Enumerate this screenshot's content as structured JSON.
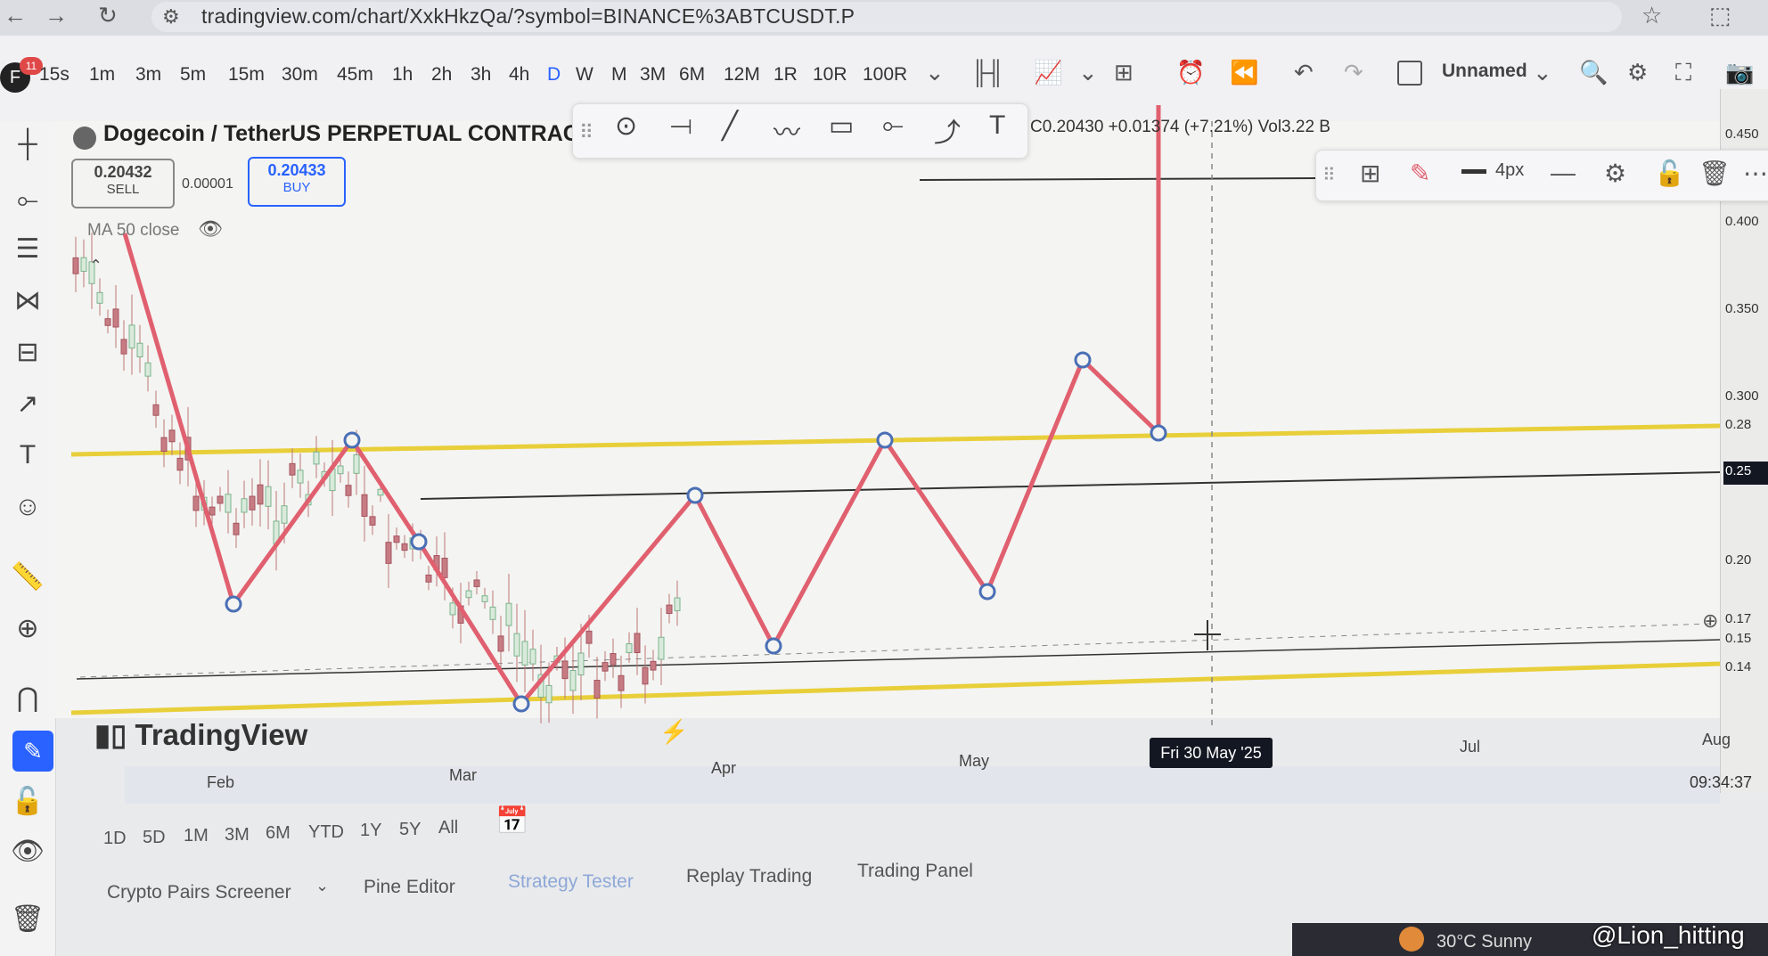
{
  "browser": {
    "url": "tradingview.com/chart/XxkHkzQa/?symbol=BINANCE%3ABTCUSDT.P",
    "back_icon": "back-arrow-icon",
    "forward_icon": "forward-arrow-icon",
    "reload_icon": "reload-icon"
  },
  "toolbar": {
    "avatar_letter": "F",
    "notification_count": "11",
    "intervals": [
      "15s",
      "1m",
      "3m",
      "5m",
      "15m",
      "30m",
      "45m",
      "1h",
      "2h",
      "3h",
      "4h",
      "D",
      "W",
      "M",
      "3M",
      "6M",
      "12M",
      "1R",
      "10R",
      "100R"
    ],
    "active_interval": "D",
    "layout_name": "Unnamed"
  },
  "symbol": {
    "title": "Dogecoin / TetherUS PERPETUAL CONTRACT ·",
    "sell_price": "0.20432",
    "sell_label": "SELL",
    "spread": "0.00001",
    "buy_price": "0.20433",
    "buy_label": "BUY",
    "indicator": "MA 50 close",
    "ohlc": "C0.20430 +0.01374 (+7.21%) Vol3.22 B"
  },
  "line_style": {
    "width_label": "4px"
  },
  "price_axis": {
    "ticks": [
      "0.450",
      "0.400",
      "0.350",
      "0.300",
      "0.28",
      "0.25",
      "0.20",
      "0.17",
      "0.15",
      "0.14"
    ]
  },
  "time_axis": {
    "months": [
      "Feb",
      "Mar",
      "Apr",
      "May",
      "Jul",
      "Aug"
    ],
    "crosshair_label": "Fri 30 May '25",
    "clock": "09:34:37"
  },
  "ranges": [
    "1D",
    "5D",
    "1M",
    "3M",
    "6M",
    "YTD",
    "1Y",
    "5Y",
    "All"
  ],
  "panels": [
    "Crypto Pairs Screener",
    "Pine Editor",
    "Strategy Tester",
    "Replay Trading",
    "Trading Panel"
  ],
  "brand": "TradingView",
  "taskbar": {
    "weather": "30°C  Sunny",
    "watermark": "@Lion_hitting"
  },
  "colors": {
    "zigzag": "#e0606f",
    "support_lines": "#e8cf3a",
    "accent": "#2962ff"
  }
}
